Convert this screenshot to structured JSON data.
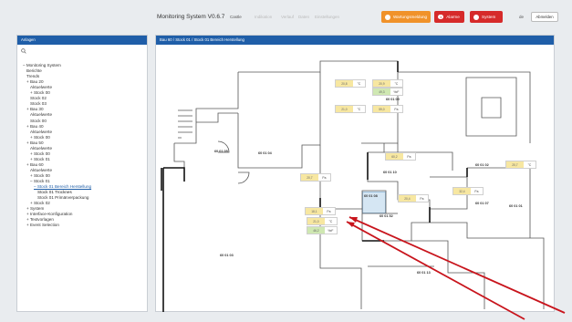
{
  "header": {
    "app_title": "Monitoring System V0.6.7",
    "nav_user": "Castle",
    "nav_items": [
      "Indikation",
      "Verlauf",
      "Daten",
      "Einstellungen"
    ],
    "alarm_buttons": [
      {
        "label": "Wartungsmeldung",
        "count": "",
        "color": "#f0922a"
      },
      {
        "label": "Alarme",
        "count": "1",
        "color": "#d62a2a"
      },
      {
        "label": "System",
        "count": "",
        "color": "#d62a2a"
      }
    ],
    "lang": "de",
    "logout_label": "Abmelden"
  },
  "sidebar": {
    "title": "Anlagen",
    "search_icon": "search-icon",
    "tree": [
      {
        "label": "– Monitoring System",
        "level": 0
      },
      {
        "label": "Berichte",
        "level": 1
      },
      {
        "label": "Trends",
        "level": 1
      },
      {
        "label": "+ Bau 20",
        "level": 1
      },
      {
        "label": "Aktuelwerte",
        "level": 2
      },
      {
        "label": "+ Stock 00",
        "level": 2
      },
      {
        "label": "Stock 02",
        "level": 2
      },
      {
        "label": "Stock 03",
        "level": 2
      },
      {
        "label": "+ Bau 30",
        "level": 1
      },
      {
        "label": "Aktuelwerte",
        "level": 2
      },
      {
        "label": "Stock 00",
        "level": 2
      },
      {
        "label": "+ Bau 40",
        "level": 1
      },
      {
        "label": "Aktuelwerte",
        "level": 2
      },
      {
        "label": "+ Stock 00",
        "level": 2
      },
      {
        "label": "+ Bau 50",
        "level": 1
      },
      {
        "label": "Aktuelwerte",
        "level": 2
      },
      {
        "label": "+ Stock 00",
        "level": 2
      },
      {
        "label": "+ Stock 01",
        "level": 2
      },
      {
        "label": "+ Bau 60",
        "level": 1
      },
      {
        "label": "Aktuelwerte",
        "level": 2
      },
      {
        "label": "+ Stock 00",
        "level": 2
      },
      {
        "label": "– Stock 01",
        "level": 2
      },
      {
        "label": "– Stock 01 Bereich Herstellung",
        "level": 3,
        "selected": true
      },
      {
        "label": "Stock 01 Trocknes",
        "level": 4,
        "dark": true
      },
      {
        "label": "Stock 01 Primärverpackung",
        "level": 4
      },
      {
        "label": "+ Stock 02",
        "level": 2
      },
      {
        "label": "+ System",
        "level": 1
      },
      {
        "label": "+ Interface-Konfiguration",
        "level": 1
      },
      {
        "label": "+ Textvorlagen",
        "level": 1
      },
      {
        "label": "+ Event Selection",
        "level": 1
      }
    ]
  },
  "main": {
    "breadcrumb": "Bau 60 / Stock 01 / Stock 01 Bereich Herstellung",
    "rooms": [
      "60 01 09",
      "60 01 05",
      "60 01 04",
      "60 01 10",
      "60 01 02",
      "60 01 08",
      "60 01 07",
      "60 01 01",
      "60 01 52",
      "60 01 03",
      "60 01 13"
    ],
    "sensors": [
      {
        "value": "20,8",
        "unit": "°C",
        "color": "#f7e7a1"
      },
      {
        "value": "20,9",
        "unit": "°C",
        "color": "#f7e7a1"
      },
      {
        "value": "49,3",
        "unit": "%rF",
        "color": "#cfe8b2"
      },
      {
        "value": "21,0",
        "unit": "°C",
        "color": "#f7e7a1"
      },
      {
        "value": "59,0",
        "unit": "Pa",
        "color": "#f7e7a1"
      },
      {
        "value": "20,7",
        "unit": "Pa",
        "color": "#f7e7a1"
      },
      {
        "value": "60,2",
        "unit": "Pa",
        "color": "#f7e7a1"
      },
      {
        "value": "32,4",
        "unit": "Pa",
        "color": "#f7e7a1"
      },
      {
        "value": "20,7",
        "unit": "°C",
        "color": "#f7e7a1"
      },
      {
        "value": "20,4",
        "unit": "Pa",
        "color": "#f7e7a1"
      },
      {
        "value": "18,1",
        "unit": "Pa",
        "color": "#f7e7a1"
      },
      {
        "value": "21,0",
        "unit": "°C",
        "color": "#f7e7a1"
      },
      {
        "value": "46,2",
        "unit": "%rF",
        "color": "#cfe8b2"
      }
    ],
    "annotation_color": "#c8141c"
  }
}
